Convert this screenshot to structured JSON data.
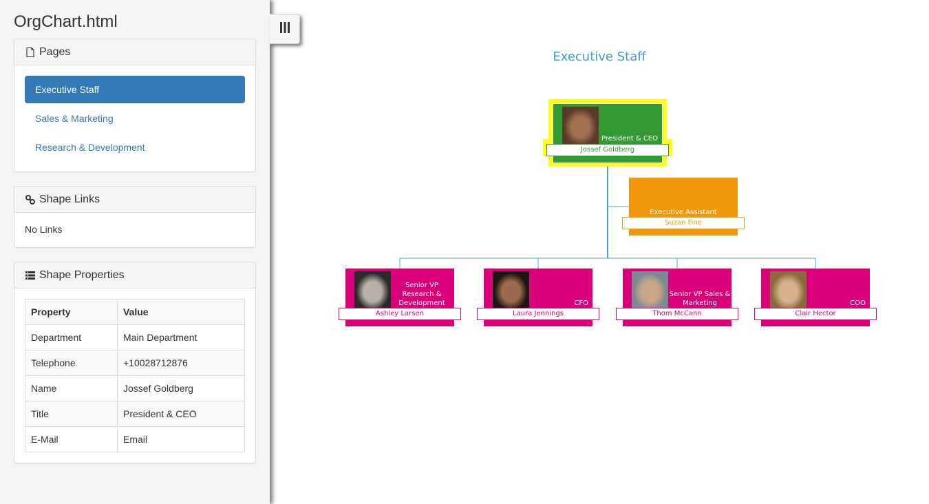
{
  "app": {
    "title": "OrgChart.html"
  },
  "sidebar": {
    "pages_panel": {
      "icon": "file-icon",
      "heading": "Pages",
      "items": [
        {
          "label": "Executive Staff",
          "active": true
        },
        {
          "label": "Sales & Marketing",
          "active": false
        },
        {
          "label": "Research & Development",
          "active": false
        }
      ]
    },
    "links_panel": {
      "icon": "link-icon",
      "heading": "Shape Links",
      "empty_text": "No Links"
    },
    "properties_panel": {
      "icon": "list-icon",
      "heading": "Shape Properties",
      "columns": [
        "Property",
        "Value"
      ],
      "rows": [
        [
          "Department",
          "Main Department"
        ],
        [
          "Telephone",
          "+10028712876"
        ],
        [
          "Name",
          "Jossef Goldberg"
        ],
        [
          "Title",
          "President & CEO"
        ],
        [
          "E-Mail",
          "Email"
        ]
      ]
    }
  },
  "toggle": {
    "icon": "columns-icon"
  },
  "orgchart": {
    "heading": "Executive Staff",
    "colors": {
      "ceo": "#339933",
      "assistant": "#f0980a",
      "vp": "#d9007a",
      "selected_outline": "#ffff1a",
      "connector": "#4ba3d8",
      "heading": "#3d9bd8"
    },
    "nodes": [
      {
        "id": "ceo",
        "name": "Jossef Goldberg",
        "title": "President & CEO",
        "role": "ceo",
        "selected": true,
        "has_photo": true
      },
      {
        "id": "assistant",
        "name": "Suzan Fine",
        "title": "Executive Assistant",
        "role": "assistant",
        "selected": false,
        "has_photo": false
      },
      {
        "id": "vp-rd",
        "name": "Ashley Larsen",
        "title": "Senior VP Research & Development",
        "role": "vp",
        "selected": false,
        "has_photo": true
      },
      {
        "id": "cfo",
        "name": "Laura Jennings",
        "title": "CFO",
        "role": "vp",
        "selected": false,
        "has_photo": true
      },
      {
        "id": "vp-sales",
        "name": "Thom McCann",
        "title": "Senior VP Sales & Marketing",
        "role": "vp",
        "selected": false,
        "has_photo": true
      },
      {
        "id": "coo",
        "name": "Clair Hector",
        "title": "COO",
        "role": "vp",
        "selected": false,
        "has_photo": true
      }
    ]
  }
}
